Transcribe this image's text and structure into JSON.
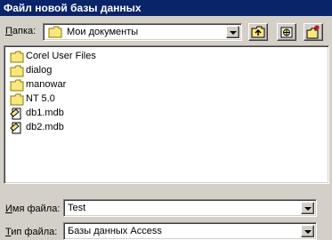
{
  "window": {
    "title": "Файл новой базы данных"
  },
  "folder": {
    "label": "Папка:",
    "accel": "П",
    "rest": "апка:",
    "value": "Мои документы",
    "icon": "folder-icon"
  },
  "toolbar": {
    "buttons": [
      {
        "name": "up-one-level-button",
        "icon": "up-folder-icon"
      },
      {
        "name": "search-web-button",
        "icon": "globe-icon"
      },
      {
        "name": "create-new-folder-button",
        "icon": "new-folder-icon"
      }
    ]
  },
  "files": [
    {
      "name": "Corel User Files",
      "icon": "folder-icon"
    },
    {
      "name": "dialog",
      "icon": "folder-icon"
    },
    {
      "name": "manowar",
      "icon": "folder-icon"
    },
    {
      "name": "NT 5.0",
      "icon": "folder-icon"
    },
    {
      "name": "db1.mdb",
      "icon": "access-db-icon"
    },
    {
      "name": "db2.mdb",
      "icon": "access-db-icon"
    }
  ],
  "filename": {
    "label": "Имя файла:",
    "accel": "И",
    "rest": "мя файла:",
    "value": "Test"
  },
  "filetype": {
    "label": "Тип файла:",
    "accel": "Т",
    "rest": "ип файла:",
    "value": "Базы данных Access"
  },
  "colors": {
    "titlebar": "#0a246a",
    "face": "#d4d0c8",
    "folder": "#fce680"
  }
}
